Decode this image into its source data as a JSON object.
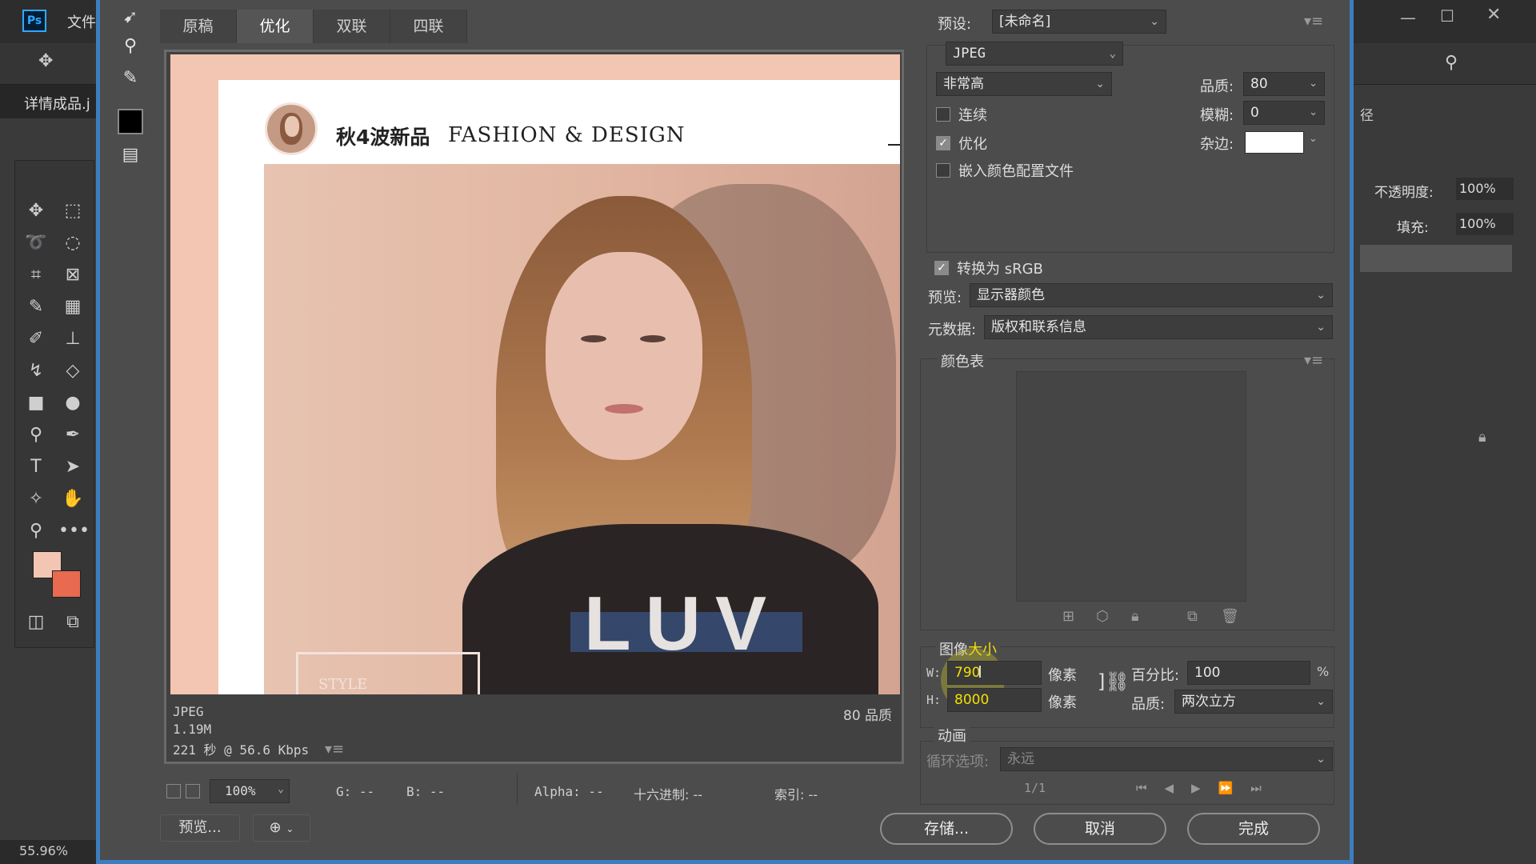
{
  "app": {
    "logo": "Ps",
    "menu_file": "文件",
    "doc_tab": "详情成品.j",
    "zoom_status": "55.96%"
  },
  "ps_right": {
    "opacity_label": "不透明度:",
    "opacity_value": "100%",
    "fill_label": "填充:",
    "fill_value": "100%",
    "path_label": "径"
  },
  "dialog": {
    "tabs": [
      "原稿",
      "优化",
      "双联",
      "四联"
    ],
    "active_tab": "优化",
    "image": {
      "headline_cn": "秋4波新品",
      "headline_en": "FASHION & DESIGN",
      "shirt_text": "LUV",
      "corner_text": "STYLE"
    },
    "info": {
      "format": "JPEG",
      "size": "1.19M",
      "time": "221 秒 @ 56.6 Kbps",
      "quality": "80 品质"
    },
    "bottom_status": {
      "zoom": "100%",
      "g": "G: --",
      "b": "B: --",
      "alpha": "Alpha: --",
      "hex": "十六进制: --",
      "index": "索引: --"
    },
    "preview_button": "预览...",
    "save_button": "存储...",
    "cancel_button": "取消",
    "done_button": "完成"
  },
  "settings": {
    "preset_label": "预设:",
    "preset_value": "[未命名]",
    "format_value": "JPEG",
    "compression_value": "非常高",
    "quality_label": "品质:",
    "quality_value": "80",
    "progressive_label": "连续",
    "blur_label": "模糊:",
    "blur_value": "0",
    "optimized_label": "优化",
    "matte_label": "杂边:",
    "embed_profile_label": "嵌入颜色配置文件",
    "convert_srgb_label": "转换为 sRGB",
    "preview_label": "预览:",
    "preview_value": "显示器颜色",
    "metadata_label": "元数据:",
    "metadata_value": "版权和联系信息",
    "color_table_label": "颜色表",
    "image_size_label_a": "图像",
    "image_size_label_b": "大小",
    "w_label": "W:",
    "w_value": "790",
    "h_label": "H:",
    "h_value": "8000",
    "px_unit": "像素",
    "percent_label": "百分比:",
    "percent_value": "100",
    "percent_unit": "%",
    "resample_label": "品质:",
    "resample_value": "两次立方",
    "animation_label": "动画",
    "loop_label": "循环选项:",
    "loop_value": "永远",
    "frame_counter": "1/1"
  }
}
